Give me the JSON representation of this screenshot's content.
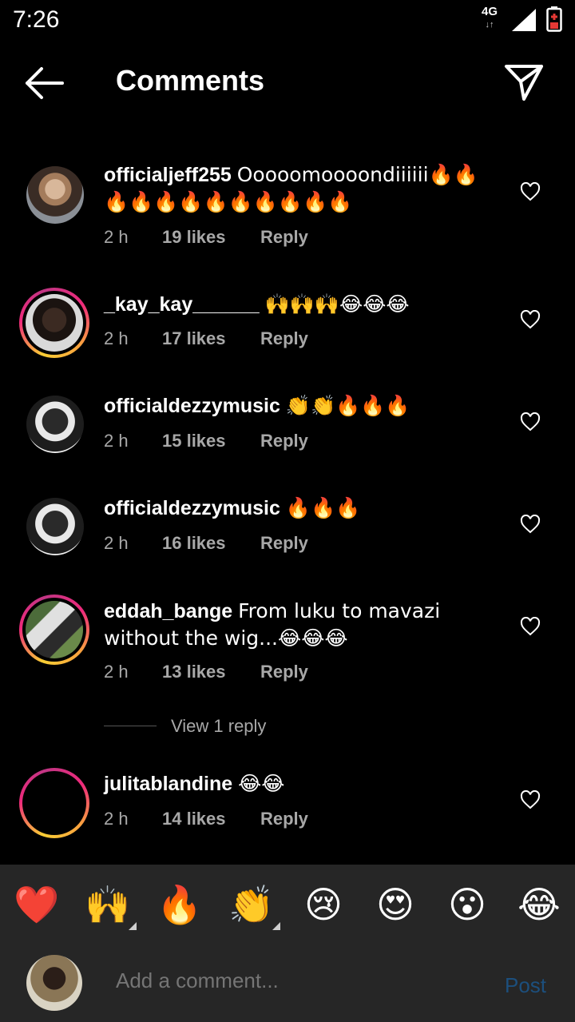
{
  "status": {
    "time": "7:26",
    "network": "4G"
  },
  "header": {
    "title": "Comments"
  },
  "comments": [
    {
      "username": "officialjeff255",
      "text": "Ooooomoooondiiiiii🔥🔥🔥🔥🔥🔥🔥🔥🔥🔥🔥🔥",
      "time": "2 h",
      "likes": "19 likes",
      "reply": "Reply"
    },
    {
      "username": "_kay_kay______",
      "text": "🙌🙌🙌😂😂😂",
      "time": "2 h",
      "likes": "17 likes",
      "reply": "Reply"
    },
    {
      "username": "officialdezzymusic",
      "text": "👏👏🔥🔥🔥",
      "time": "2 h",
      "likes": "15 likes",
      "reply": "Reply"
    },
    {
      "username": "officialdezzymusic",
      "text": "🔥🔥🔥",
      "time": "2 h",
      "likes": "16 likes",
      "reply": "Reply"
    },
    {
      "username": "eddah_bange",
      "text": "From luku to mavazi without the wig...😂😂😂",
      "time": "2 h",
      "likes": "13 likes",
      "reply": "Reply"
    },
    {
      "username": "julitablandine",
      "text": "😂😂",
      "time": "2 h",
      "likes": "14 likes",
      "reply": "Reply"
    }
  ],
  "view_replies": "View 1 reply",
  "reactions": [
    "❤️",
    "🙌",
    "🔥",
    "👏",
    "😢",
    "😍",
    "😮",
    "😂"
  ],
  "composer": {
    "placeholder": "Add a comment...",
    "post_label": "Post"
  },
  "colors": {
    "background": "#000000",
    "panel": "#262626",
    "meta_text": "#a8a8a8",
    "post_disabled": "#1c4f7d"
  }
}
